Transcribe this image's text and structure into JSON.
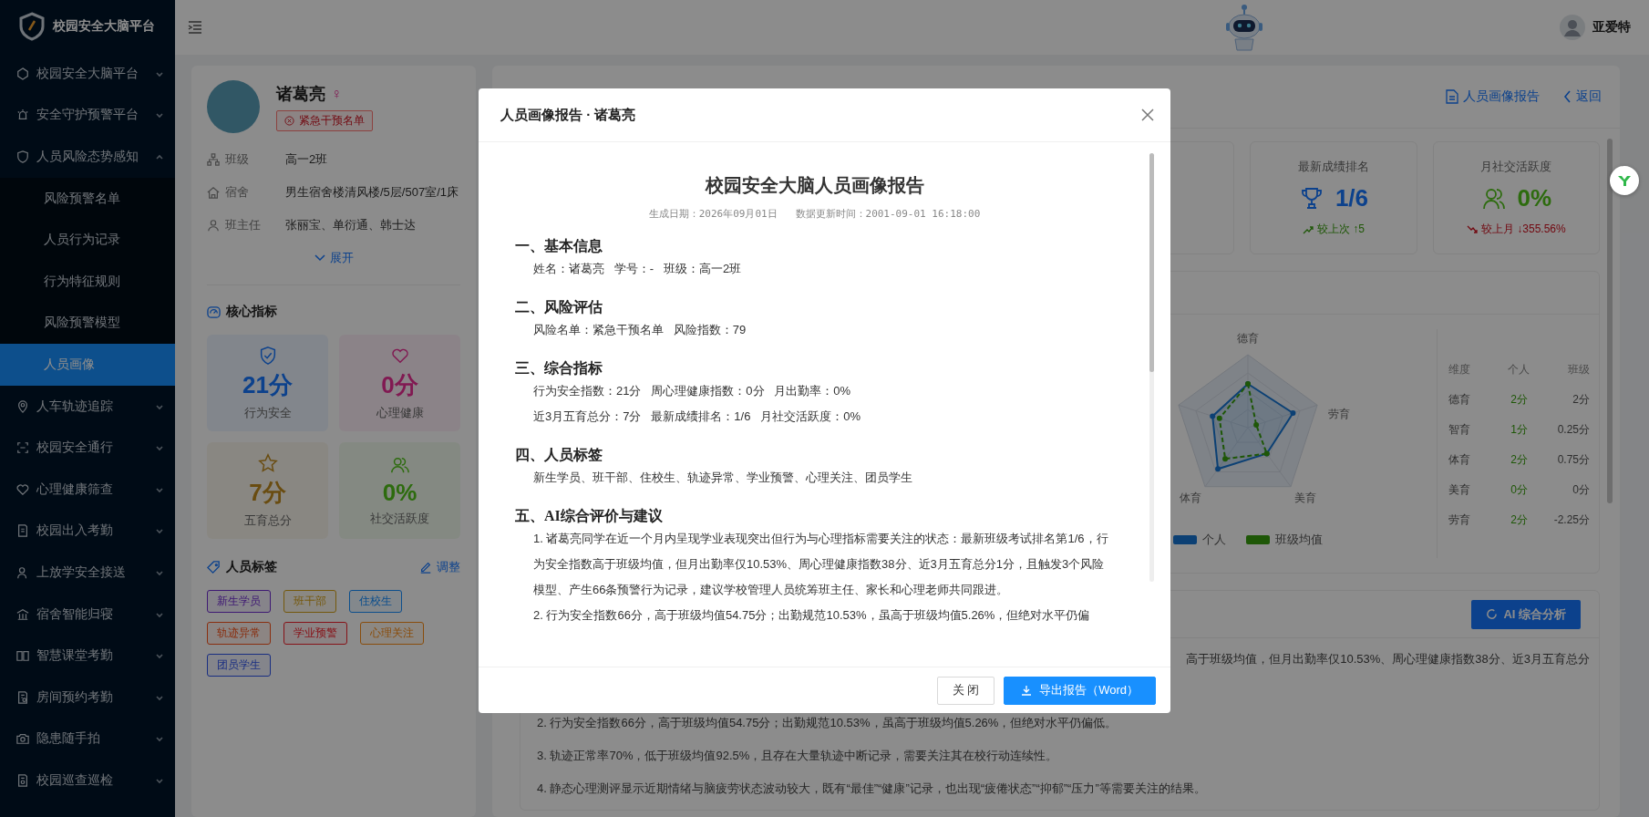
{
  "sidebar": {
    "logo_text": "校园安全大脑平台",
    "items": [
      {
        "label": "校园安全大脑平台",
        "expanded": false
      },
      {
        "label": "安全守护预警平台",
        "expanded": false
      },
      {
        "label": "人员风险态势感知",
        "expanded": true,
        "children": [
          {
            "label": "风险预警名单",
            "selected": false
          },
          {
            "label": "人员行为记录",
            "selected": false
          },
          {
            "label": "行为特征规则",
            "selected": false
          },
          {
            "label": "风险预警模型",
            "selected": false
          },
          {
            "label": "人员画像",
            "selected": true
          }
        ]
      },
      {
        "label": "人车轨迹追踪",
        "expanded": false
      },
      {
        "label": "校园安全通行",
        "expanded": false
      },
      {
        "label": "心理健康筛查",
        "expanded": false
      },
      {
        "label": "校园出入考勤",
        "expanded": false
      },
      {
        "label": "上放学安全接送",
        "expanded": false
      },
      {
        "label": "宿舍智能归寝",
        "expanded": false
      },
      {
        "label": "智慧课堂考勤",
        "expanded": false
      },
      {
        "label": "房间预约考勤",
        "expanded": false
      },
      {
        "label": "隐患随手拍",
        "expanded": false
      },
      {
        "label": "校园巡查巡检",
        "expanded": false
      }
    ]
  },
  "header": {
    "user_name": "亚爱特"
  },
  "profile": {
    "name": "诸葛亮",
    "gender_symbol": "♀",
    "badge": "紧急干预名单",
    "info": [
      {
        "label": "班级",
        "value": "高一2班"
      },
      {
        "label": "宿舍",
        "value": "男生宿舍楼清风楼/5层/507室/1床"
      },
      {
        "label": "班主任",
        "value": "张丽宝、单衍通、韩士达"
      }
    ],
    "expand_link": "展开",
    "metrics_title": "核心指标",
    "metrics": [
      {
        "value": "21分",
        "label": "行为安全"
      },
      {
        "value": "0分",
        "label": "心理健康"
      },
      {
        "value": "7分",
        "label": "五育总分"
      },
      {
        "value": "0%",
        "label": "社交活跃度"
      }
    ],
    "tags_title": "人员标签",
    "tags_edit": "调整",
    "tags": [
      {
        "label": "新生学员"
      },
      {
        "label": "班干部"
      },
      {
        "label": "住校生"
      },
      {
        "label": "轨迹异常"
      },
      {
        "label": "学业预警"
      },
      {
        "label": "心理关注"
      },
      {
        "label": "团员学生"
      }
    ]
  },
  "main": {
    "report_link": "人员画像报告",
    "back_link": "返回",
    "stats": [
      {
        "title": "最新成绩排名",
        "value": "1/6",
        "trend": "较上次 ↑5",
        "rising": true
      },
      {
        "title": "月社交活跃度",
        "value": "0%",
        "trend": "较上月 ↓355.56%",
        "rising": false
      }
    ],
    "radar": {
      "labels": [
        "德育",
        "劳育",
        "美育",
        "体育"
      ],
      "legend": [
        {
          "label": "个人",
          "color": "#0c4174"
        },
        {
          "label": "班级均值",
          "color": "#1f5707"
        }
      ]
    },
    "table": {
      "columns": [
        "维度",
        "个人",
        "班级"
      ],
      "rows": [
        [
          "德育",
          "2分",
          "2分"
        ],
        [
          "智育",
          "1分",
          "0.25分"
        ],
        [
          "体育",
          "2分",
          "0.75分"
        ],
        [
          "美育",
          "0分",
          "0分"
        ],
        [
          "劳育",
          "2分",
          "-2.25分"
        ]
      ]
    },
    "ai": {
      "button": "AI 综合分析",
      "fragment": "高于班级均值，但月出勤率仅10.53%、周心理健康指数38分、近3月五育总分",
      "paragraphs": [
        "2. 行为安全指数66分，高于班级均值54.75分；出勤规范10.53%，虽高于班级均值5.26%，但绝对水平仍偏低。",
        "3. 轨迹正常率70%，低于班级均值92.5%，且存在大量轨迹中断记录，需要关注其在校行动连续性。",
        "4. 静态心理测评显示近期情绪与脑疲劳状态波动较大，既有“最佳”“健康”记录，也出现“疲倦状态”“抑郁”“压力”等需要关注的结果。"
      ]
    }
  },
  "modal": {
    "title": "人员画像报告 · 诸葛亮",
    "report_title": "校园安全大脑人员画像报告",
    "meta": "生成日期：2026年09月01日   数据更新时间：2001-09-01 16:18:00",
    "sections": [
      {
        "heading": "一、基本信息",
        "lines": [
          "姓名：诸葛亮   学号：-   班级：高一2班"
        ]
      },
      {
        "heading": "二、风险评估",
        "lines": [
          "风险名单：紧急干预名单   风险指数：79"
        ]
      },
      {
        "heading": "三、综合指标",
        "lines": [
          "行为安全指数：21分   周心理健康指数：0分   月出勤率：0%",
          "近3月五育总分：7分   最新成绩排名：1/6   月社交活跃度：0%"
        ]
      },
      {
        "heading": "四、人员标签",
        "lines": [
          "新生学员、班干部、住校生、轨迹异常、学业预警、心理关注、团员学生"
        ]
      },
      {
        "heading": "五、AI综合评价与建议",
        "lines": [
          "1. 诸葛亮同学在近一个月内呈现学业表现突出但行为与心理指标需要关注的状态：最新班级考试排名第1/6，行为安全指数高于班级均值，但月出勤率仅10.53%、周心理健康指数38分、近3月五育总分1分，且触发3个风险模型、产生66条预警行为记录，建议学校管理人员统筹班主任、家长和心理老师共同跟进。",
          "2. 行为安全指数66分，高于班级均值54.75分；出勤规范10.53%，虽高于班级均值5.26%，但绝对水平仍偏"
        ]
      }
    ],
    "buttons": [
      {
        "label": "关 闭",
        "kind": "default"
      },
      {
        "label": "导出报告（Word）",
        "kind": "primary"
      }
    ]
  }
}
